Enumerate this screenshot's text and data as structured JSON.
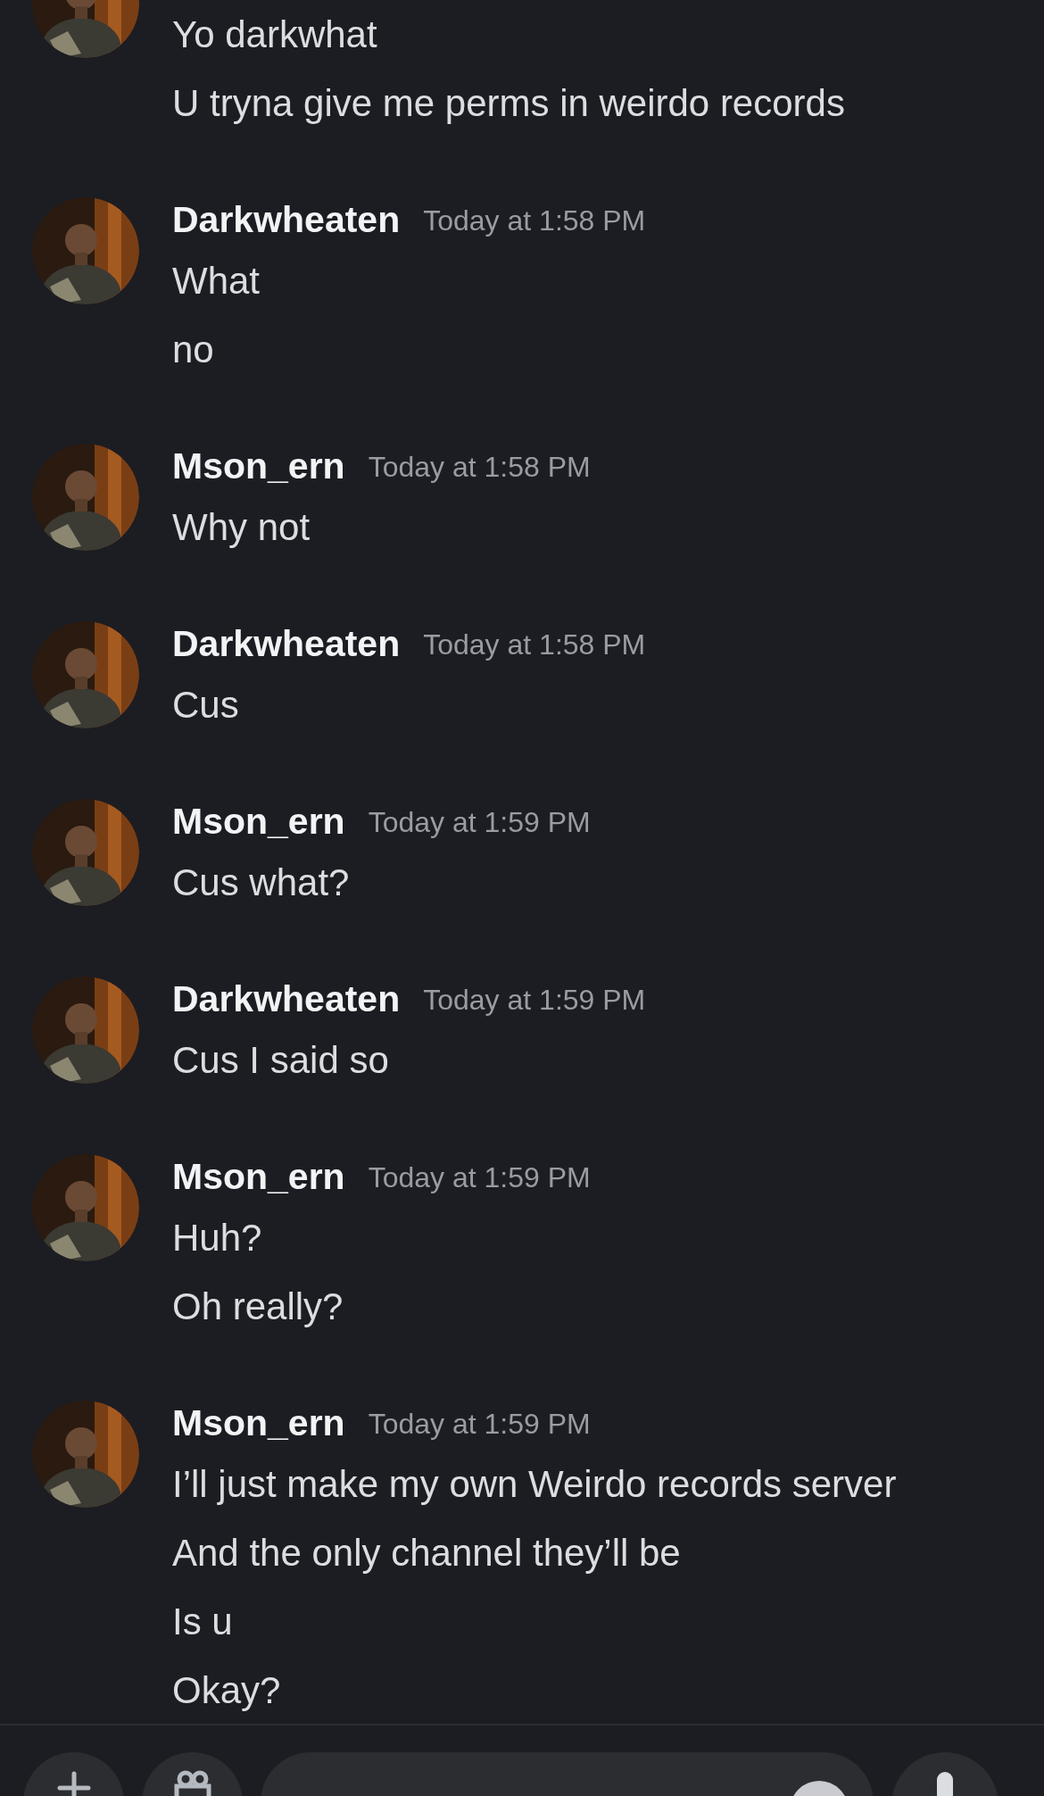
{
  "messages": [
    {
      "avatar": {
        "kind": "picture"
      },
      "lines": [
        "Yo darkwhat",
        "U tryna give me perms in weirdo records"
      ]
    },
    {
      "author": "Darkwheaten",
      "time": "Today at 1:58 PM",
      "avatar": {
        "kind": "picture"
      },
      "lines": [
        "What",
        "no"
      ]
    },
    {
      "author": "Mson_ern",
      "time": "Today at 1:58 PM",
      "avatar": {
        "kind": "picture"
      },
      "lines": [
        "Why not"
      ]
    },
    {
      "author": "Darkwheaten",
      "time": "Today at 1:58 PM",
      "avatar": {
        "kind": "picture"
      },
      "lines": [
        "Cus"
      ]
    },
    {
      "author": "Mson_ern",
      "time": "Today at 1:59 PM",
      "avatar": {
        "kind": "picture"
      },
      "lines": [
        "Cus what?"
      ]
    },
    {
      "author": "Darkwheaten",
      "time": "Today at 1:59 PM",
      "avatar": {
        "kind": "picture"
      },
      "lines": [
        "Cus I said so"
      ]
    },
    {
      "author": "Mson_ern",
      "time": "Today at 1:59 PM",
      "avatar": {
        "kind": "picture"
      },
      "lines": [
        "Huh?",
        "Oh really?"
      ]
    },
    {
      "author": "Mson_ern",
      "time": "Today at 1:59 PM",
      "avatar": {
        "kind": "picture"
      },
      "lines": [
        "I’ll just make my own Weirdo records server",
        "And the only channel they’ll be",
        "Is u",
        "Okay?"
      ]
    }
  ]
}
